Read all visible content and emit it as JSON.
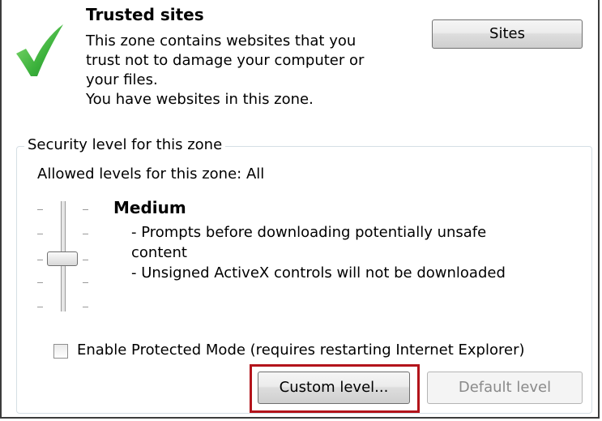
{
  "zone": {
    "title": "Trusted sites",
    "description_lines": [
      "This zone contains websites that you",
      "trust not to damage your computer or",
      "your files.",
      "You have websites in this zone."
    ],
    "sites_button": "Sites",
    "icon": "checkmark-icon"
  },
  "security": {
    "group_label": "Security level for this zone",
    "allowed_levels": "Allowed levels for this zone: All",
    "level_name": "Medium",
    "level_description": [
      "- Prompts before downloading potentially unsafe",
      "content",
      "- Unsigned ActiveX controls will not be downloaded"
    ],
    "slider_level": "Medium"
  },
  "protected_mode": {
    "label": "Enable Protected Mode (requires restarting Internet Explorer)",
    "checked": false
  },
  "buttons": {
    "custom_level": "Custom level...",
    "default_level": "Default level",
    "default_level_enabled": false
  },
  "colors": {
    "highlight": "#b3141b",
    "check_green": "#3cb23c"
  }
}
